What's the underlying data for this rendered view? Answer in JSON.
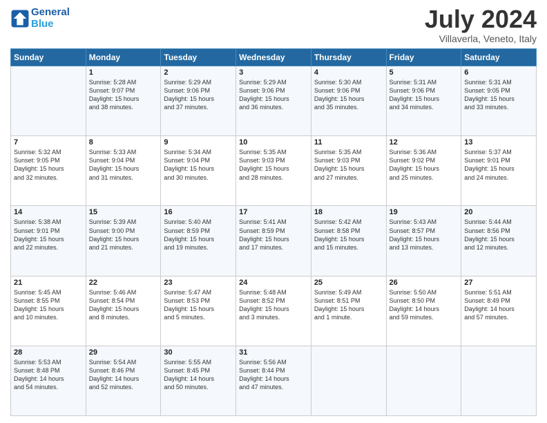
{
  "header": {
    "logo_line1": "General",
    "logo_line2": "Blue",
    "month_title": "July 2024",
    "location": "Villaverla, Veneto, Italy"
  },
  "days_of_week": [
    "Sunday",
    "Monday",
    "Tuesday",
    "Wednesday",
    "Thursday",
    "Friday",
    "Saturday"
  ],
  "weeks": [
    [
      {
        "day": "",
        "text": ""
      },
      {
        "day": "1",
        "text": "Sunrise: 5:28 AM\nSunset: 9:07 PM\nDaylight: 15 hours\nand 38 minutes."
      },
      {
        "day": "2",
        "text": "Sunrise: 5:29 AM\nSunset: 9:06 PM\nDaylight: 15 hours\nand 37 minutes."
      },
      {
        "day": "3",
        "text": "Sunrise: 5:29 AM\nSunset: 9:06 PM\nDaylight: 15 hours\nand 36 minutes."
      },
      {
        "day": "4",
        "text": "Sunrise: 5:30 AM\nSunset: 9:06 PM\nDaylight: 15 hours\nand 35 minutes."
      },
      {
        "day": "5",
        "text": "Sunrise: 5:31 AM\nSunset: 9:06 PM\nDaylight: 15 hours\nand 34 minutes."
      },
      {
        "day": "6",
        "text": "Sunrise: 5:31 AM\nSunset: 9:05 PM\nDaylight: 15 hours\nand 33 minutes."
      }
    ],
    [
      {
        "day": "7",
        "text": "Sunrise: 5:32 AM\nSunset: 9:05 PM\nDaylight: 15 hours\nand 32 minutes."
      },
      {
        "day": "8",
        "text": "Sunrise: 5:33 AM\nSunset: 9:04 PM\nDaylight: 15 hours\nand 31 minutes."
      },
      {
        "day": "9",
        "text": "Sunrise: 5:34 AM\nSunset: 9:04 PM\nDaylight: 15 hours\nand 30 minutes."
      },
      {
        "day": "10",
        "text": "Sunrise: 5:35 AM\nSunset: 9:03 PM\nDaylight: 15 hours\nand 28 minutes."
      },
      {
        "day": "11",
        "text": "Sunrise: 5:35 AM\nSunset: 9:03 PM\nDaylight: 15 hours\nand 27 minutes."
      },
      {
        "day": "12",
        "text": "Sunrise: 5:36 AM\nSunset: 9:02 PM\nDaylight: 15 hours\nand 25 minutes."
      },
      {
        "day": "13",
        "text": "Sunrise: 5:37 AM\nSunset: 9:01 PM\nDaylight: 15 hours\nand 24 minutes."
      }
    ],
    [
      {
        "day": "14",
        "text": "Sunrise: 5:38 AM\nSunset: 9:01 PM\nDaylight: 15 hours\nand 22 minutes."
      },
      {
        "day": "15",
        "text": "Sunrise: 5:39 AM\nSunset: 9:00 PM\nDaylight: 15 hours\nand 21 minutes."
      },
      {
        "day": "16",
        "text": "Sunrise: 5:40 AM\nSunset: 8:59 PM\nDaylight: 15 hours\nand 19 minutes."
      },
      {
        "day": "17",
        "text": "Sunrise: 5:41 AM\nSunset: 8:59 PM\nDaylight: 15 hours\nand 17 minutes."
      },
      {
        "day": "18",
        "text": "Sunrise: 5:42 AM\nSunset: 8:58 PM\nDaylight: 15 hours\nand 15 minutes."
      },
      {
        "day": "19",
        "text": "Sunrise: 5:43 AM\nSunset: 8:57 PM\nDaylight: 15 hours\nand 13 minutes."
      },
      {
        "day": "20",
        "text": "Sunrise: 5:44 AM\nSunset: 8:56 PM\nDaylight: 15 hours\nand 12 minutes."
      }
    ],
    [
      {
        "day": "21",
        "text": "Sunrise: 5:45 AM\nSunset: 8:55 PM\nDaylight: 15 hours\nand 10 minutes."
      },
      {
        "day": "22",
        "text": "Sunrise: 5:46 AM\nSunset: 8:54 PM\nDaylight: 15 hours\nand 8 minutes."
      },
      {
        "day": "23",
        "text": "Sunrise: 5:47 AM\nSunset: 8:53 PM\nDaylight: 15 hours\nand 5 minutes."
      },
      {
        "day": "24",
        "text": "Sunrise: 5:48 AM\nSunset: 8:52 PM\nDaylight: 15 hours\nand 3 minutes."
      },
      {
        "day": "25",
        "text": "Sunrise: 5:49 AM\nSunset: 8:51 PM\nDaylight: 15 hours\nand 1 minute."
      },
      {
        "day": "26",
        "text": "Sunrise: 5:50 AM\nSunset: 8:50 PM\nDaylight: 14 hours\nand 59 minutes."
      },
      {
        "day": "27",
        "text": "Sunrise: 5:51 AM\nSunset: 8:49 PM\nDaylight: 14 hours\nand 57 minutes."
      }
    ],
    [
      {
        "day": "28",
        "text": "Sunrise: 5:53 AM\nSunset: 8:48 PM\nDaylight: 14 hours\nand 54 minutes."
      },
      {
        "day": "29",
        "text": "Sunrise: 5:54 AM\nSunset: 8:46 PM\nDaylight: 14 hours\nand 52 minutes."
      },
      {
        "day": "30",
        "text": "Sunrise: 5:55 AM\nSunset: 8:45 PM\nDaylight: 14 hours\nand 50 minutes."
      },
      {
        "day": "31",
        "text": "Sunrise: 5:56 AM\nSunset: 8:44 PM\nDaylight: 14 hours\nand 47 minutes."
      },
      {
        "day": "",
        "text": ""
      },
      {
        "day": "",
        "text": ""
      },
      {
        "day": "",
        "text": ""
      }
    ]
  ]
}
